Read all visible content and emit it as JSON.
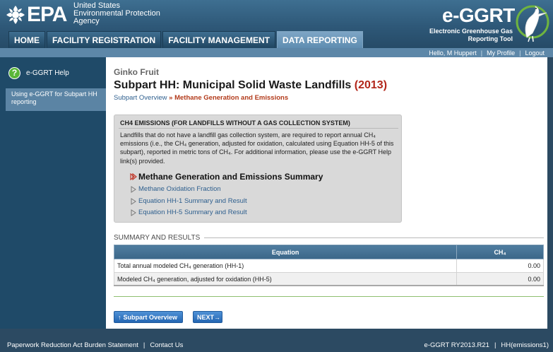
{
  "header": {
    "epa_logo_text": "EPA",
    "agency_lines": [
      "United States",
      "Environmental Protection",
      "Agency"
    ],
    "app_title": "e-GGRT",
    "app_subtitle_lines": [
      "Electronic Greenhouse Gas",
      "Reporting Tool"
    ]
  },
  "nav": {
    "tabs": [
      {
        "label": "HOME",
        "active": false
      },
      {
        "label": "FACILITY REGISTRATION",
        "active": false
      },
      {
        "label": "FACILITY MANAGEMENT",
        "active": false
      },
      {
        "label": "DATA REPORTING",
        "active": true
      }
    ]
  },
  "userbar": {
    "greeting": "Hello, M Huppert",
    "my_profile": "My Profile",
    "logout": "Logout"
  },
  "sidebar": {
    "help_title": "e-GGRT Help",
    "help_link": "Using e-GGRT for Subpart HH reporting"
  },
  "main": {
    "facility_name": "Ginko Fruit",
    "title": "Subpart HH: Municipal Solid Waste Landfills",
    "year": "(2013)",
    "breadcrumb_link": "Subpart Overview",
    "breadcrumb_sep": "»",
    "breadcrumb_current": "Methane Generation and Emissions",
    "info_heading": "CH4 EMISSIONS (FOR LANDFILLS WITHOUT A GAS COLLECTION SYSTEM)",
    "info_text": "Landfills that do not have a landfill gas collection system, are required to report annual CH₄ emissions (i.e., the CH₄ generation, adjusted for oxidation, calculated using Equation HH-5 of this subpart), reported in metric tons of CH₄. For additional information, please use the e-GGRT Help link(s) provided.",
    "steps": [
      {
        "label": "Methane Generation and Emissions Summary",
        "current": true
      },
      {
        "label": "Methane Oxidation Fraction",
        "current": false
      },
      {
        "label": "Equation HH-1 Summary and Result",
        "current": false
      },
      {
        "label": "Equation HH-5 Summary and Result",
        "current": false
      }
    ],
    "summary_heading": "SUMMARY AND RESULTS",
    "table": {
      "headers": [
        "Equation",
        "CH₄"
      ],
      "rows": [
        [
          "Total annual modeled CH₄ generation (HH-1)",
          "0.00"
        ],
        [
          "Modeled CH₄ generation, adjusted for oxidation (HH-5)",
          "0.00"
        ]
      ]
    },
    "buttons": {
      "overview": "Subpart Overview",
      "next": "NEXT"
    }
  },
  "footer": {
    "paperwork": "Paperwork Reduction Act Burden Statement",
    "contact": "Contact Us",
    "version": "e-GGRT RY2013.R21",
    "screen_id": "HH(emissions1)"
  },
  "colors": {
    "header_blue": "#2e5878",
    "active_tab": "#6f98ba",
    "year_red": "#b2261a",
    "link_blue": "#2e5f8e",
    "button_blue": "#2466b2"
  }
}
